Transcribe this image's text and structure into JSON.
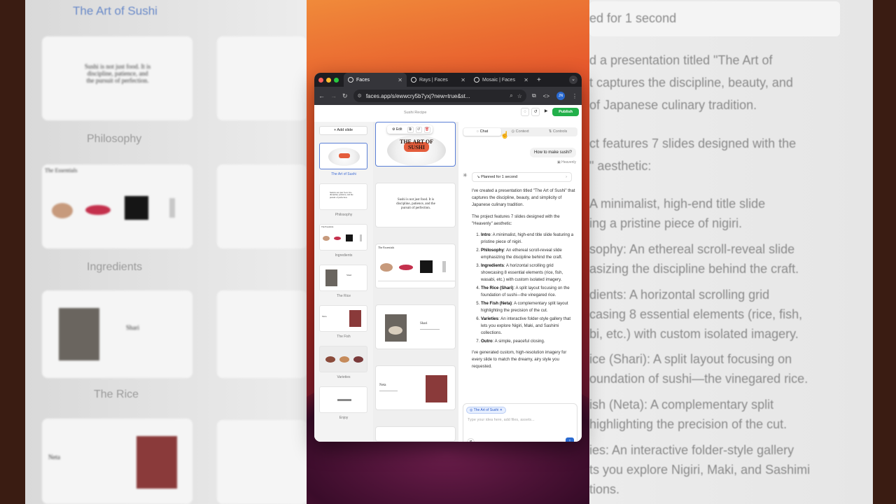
{
  "background": {
    "left": {
      "title": "The Art of Sushi",
      "labels": [
        "Philosophy",
        "Ingredients",
        "The Rice"
      ],
      "quote": "Sushi is not just food. It is discipline, patience, and the pursuit of perfection.",
      "essentials_title": "The Essentials",
      "rice_word": "Shari",
      "fish_word": "Neta"
    },
    "right": {
      "lines": [
        "ed for 1 second",
        "d a presentation titled \"The Art of",
        "t captures the discipline, beauty, and",
        "of Japanese culinary tradition.",
        "ct features 7 slides designed with the",
        "\" aesthetic:",
        "A minimalist, high-end title slide",
        "ing a pristine piece of nigiri.",
        "sophy: An ethereal scroll-reveal slide",
        "asizing the discipline behind the craft.",
        "dients: A horizontal scrolling grid",
        "casing 8 essential elements (rice, fish,",
        "bi, etc.) with custom isolated imagery.",
        "ice (Shari): A split layout focusing on",
        "oundation of sushi—the vinegared rice.",
        "ish (Neta): A complementary split",
        " highlighting the precision of the cut.",
        "ies: An interactive folder-style gallery",
        "ts you explore Nigiri, Maki, and Sashimi",
        "tions."
      ]
    }
  },
  "browser": {
    "tabs": [
      {
        "label": "Faces",
        "active": true
      },
      {
        "label": "Rays | Faces",
        "active": false
      },
      {
        "label": "Mosaic | Faces",
        "active": false
      }
    ],
    "url": "faces.app/s/ewwcry5b7yxj?new=true&st...",
    "avatar": "JN"
  },
  "app": {
    "deck_name": "Sushi Recipe",
    "publish_label": "Publish",
    "add_slide_label": "Add slide",
    "slides": [
      {
        "label": "The Art of Sushi",
        "selected": true
      },
      {
        "label": "Philosophy",
        "selected": false
      },
      {
        "label": "Ingredients",
        "selected": false
      },
      {
        "label": "The Rice",
        "selected": false
      },
      {
        "label": "The Fish",
        "selected": false
      },
      {
        "label": "Varieties",
        "selected": false
      },
      {
        "label": "Enjoy",
        "selected": false
      }
    ],
    "preview": {
      "edit_label": "Edit",
      "title_slide_text": "THE ART OF SUSHI",
      "quote": "Sushi is not just food. It is discipline, patience, and the pursuit of perfection.",
      "essentials_title": "The Essentials",
      "rice_word": "Shari",
      "fish_word": "Neta"
    },
    "chat": {
      "tabs": [
        "Chat",
        "Context",
        "Controls"
      ],
      "user_message": "How to make sushi?",
      "model_name": "Heavenly",
      "planned": "Planned for 1 second",
      "intro": "I've created a presentation titled \"The Art of Sushi\" that captures the discipline, beauty, and simplicity of Japanese culinary tradition.",
      "features": "The project features 7 slides designed with the \"Heavenly\" aesthetic:",
      "items": [
        {
          "title": "Intro",
          "text": ": A minimalist, high-end title slide featuring a pristine piece of nigiri."
        },
        {
          "title": "Philosophy",
          "text": ": An ethereal scroll-reveal slide emphasizing the discipline behind the craft."
        },
        {
          "title": "Ingredients",
          "text": ": A horizontal scrolling grid showcasing 8 essential elements (rice, fish, wasabi, etc.) with custom isolated imagery."
        },
        {
          "title": "The Rice (Shari)",
          "text": ": A split layout focusing on the foundation of sushi—the vinegared rice."
        },
        {
          "title": "The Fish (Neta)",
          "text": ": A complementary split layout highlighting the precision of the cut."
        },
        {
          "title": "Varieties",
          "text": ": An interactive folder-style gallery that lets you explore Nigiri, Maki, and Sashimi collections."
        },
        {
          "title": "Outro",
          "text": ": A simple, peaceful closing."
        }
      ],
      "outro": "I've generated custom, high-resolution imagery for every slide to match the dreamy, airy style you requested.",
      "context_chip": "The Art of Sushi",
      "placeholder": "Type your idea here, add files, assets..."
    }
  }
}
